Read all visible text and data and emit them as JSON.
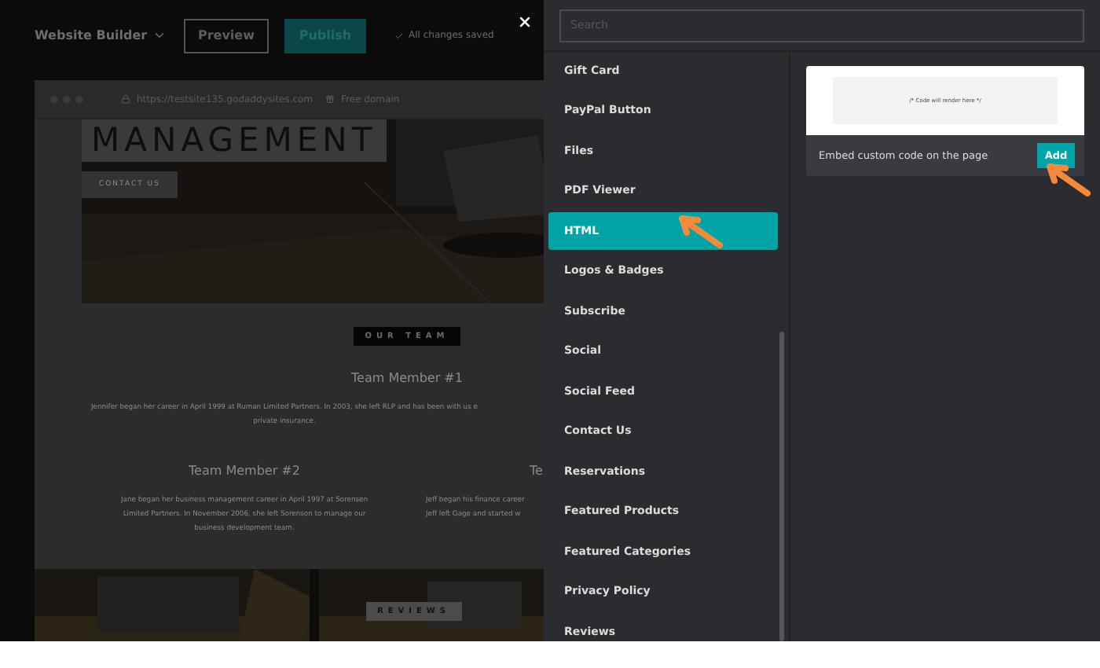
{
  "topbar": {
    "brand": "Website Builder",
    "preview": "Preview",
    "publish": "Publish",
    "status": "All changes saved"
  },
  "site_preview": {
    "url": "https://testsite135.godaddysites.com",
    "domain": "Free domain",
    "hero_title": "MANAGEMENT",
    "hero_button": "CONTACT US",
    "section_badge": "OUR TEAM",
    "members": [
      {
        "name": "Team Member #1",
        "lines": [
          "Jennifer began her career in April 1999 at Ruman Limited Partners. In 2003, she left RLP and has been with us e",
          "private insurance."
        ]
      },
      {
        "name": "Team Member #2",
        "lines": [
          "Jane began her business management career in April 1997 at Sorensen",
          "Limited Partners. In November 2006, she left Sorenson to manage our",
          "business development team."
        ]
      },
      {
        "name": "Te",
        "lines": [
          "Jeff began his finance career",
          "Jeff left Gage and started w"
        ]
      }
    ],
    "reviews_badge": "REVIEWS"
  },
  "search": {
    "placeholder": "Search"
  },
  "sections": [
    {
      "label": "Gift Card",
      "selected": false
    },
    {
      "label": "PayPal Button",
      "selected": false
    },
    {
      "label": "Files",
      "selected": false
    },
    {
      "label": "PDF Viewer",
      "selected": false
    },
    {
      "label": "HTML",
      "selected": true
    },
    {
      "label": "Logos & Badges",
      "selected": false
    },
    {
      "label": "Subscribe",
      "selected": false
    },
    {
      "label": "Social",
      "selected": false
    },
    {
      "label": "Social Feed",
      "selected": false
    },
    {
      "label": "Contact Us",
      "selected": false
    },
    {
      "label": "Reservations",
      "selected": false
    },
    {
      "label": "Featured Products",
      "selected": false
    },
    {
      "label": "Featured Categories",
      "selected": false
    },
    {
      "label": "Privacy Policy",
      "selected": false
    },
    {
      "label": "Reviews",
      "selected": false
    }
  ],
  "detail": {
    "code_placeholder": "/* Code will render here */",
    "description": "Embed custom code on the page",
    "add": "Add"
  }
}
